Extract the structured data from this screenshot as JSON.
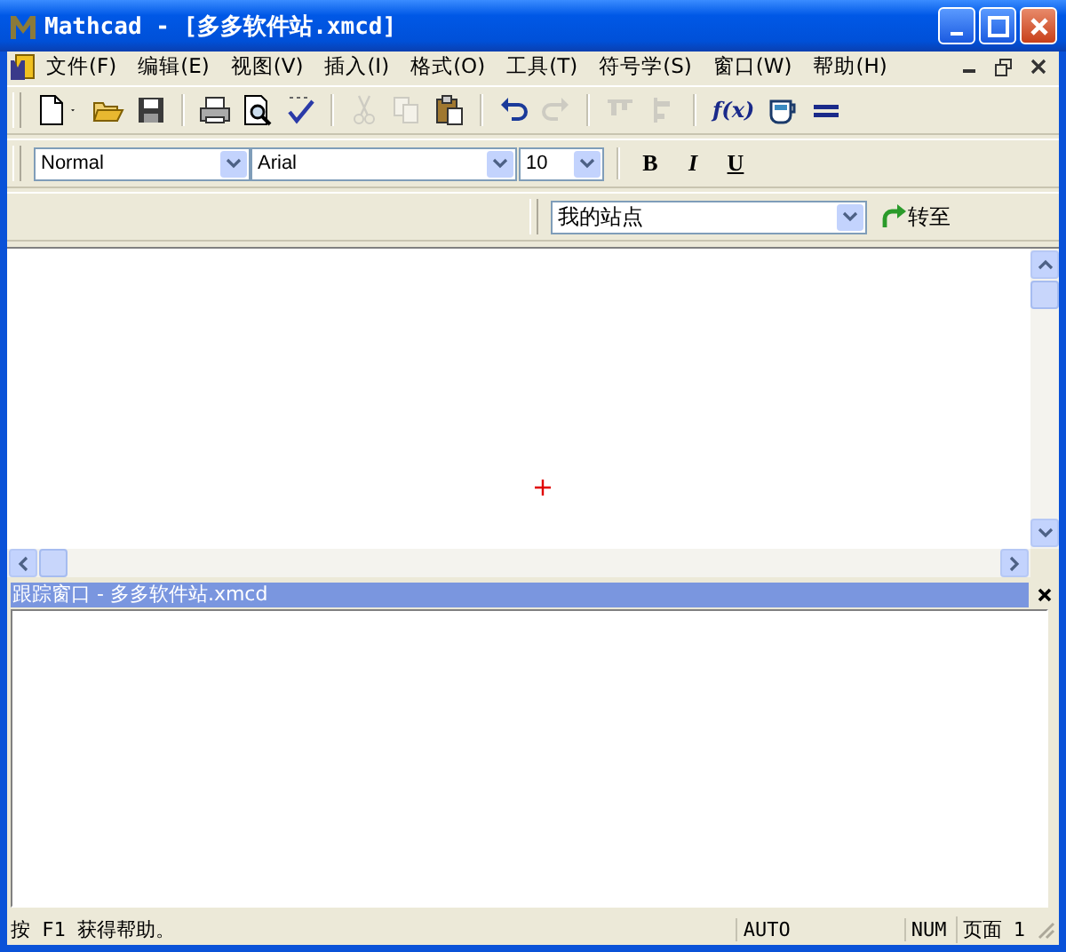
{
  "window": {
    "title": "Mathcad - [多多软件站.xmcd]"
  },
  "menus": [
    {
      "label": "文件(F)"
    },
    {
      "label": "编辑(E)"
    },
    {
      "label": "视图(V)"
    },
    {
      "label": "插入(I)"
    },
    {
      "label": "格式(O)"
    },
    {
      "label": "工具(T)"
    },
    {
      "label": "符号学(S)"
    },
    {
      "label": "窗口(W)"
    },
    {
      "label": "帮助(H)"
    }
  ],
  "toolbar": [
    {
      "kind": "new",
      "disabled": false
    },
    {
      "kind": "dropdown",
      "disabled": false
    },
    {
      "kind": "open",
      "disabled": false
    },
    {
      "kind": "save",
      "disabled": false
    },
    {
      "kind": "separator"
    },
    {
      "kind": "print",
      "disabled": false
    },
    {
      "kind": "preview",
      "disabled": false
    },
    {
      "kind": "spell",
      "disabled": false
    },
    {
      "kind": "separator"
    },
    {
      "kind": "cut",
      "disabled": true
    },
    {
      "kind": "copy",
      "disabled": true
    },
    {
      "kind": "paste",
      "disabled": false
    },
    {
      "kind": "separator"
    },
    {
      "kind": "undo",
      "disabled": false
    },
    {
      "kind": "redo",
      "disabled": true
    },
    {
      "kind": "separator"
    },
    {
      "kind": "align_top",
      "disabled": true
    },
    {
      "kind": "align_left",
      "disabled": true
    },
    {
      "kind": "separator"
    },
    {
      "kind": "function",
      "label": "f(x)",
      "disabled": false
    },
    {
      "kind": "resource",
      "disabled": false
    },
    {
      "kind": "equals",
      "disabled": false
    }
  ],
  "format_bar": {
    "style": "Normal",
    "font": "Arial",
    "size": "10",
    "buttons": [
      {
        "kind": "bold",
        "label": "B"
      },
      {
        "kind": "italic",
        "label": "I"
      },
      {
        "kind": "underline",
        "label": "U"
      }
    ]
  },
  "navigation": {
    "address": "我的站点",
    "go_button": "转至"
  },
  "trace_window": {
    "title": "跟踪窗口 - 多多软件站.xmcd"
  },
  "status_bar": {
    "message": "按 F1 获得帮助。",
    "mode": "AUTO",
    "num": "NUM",
    "page": "页面 1"
  }
}
